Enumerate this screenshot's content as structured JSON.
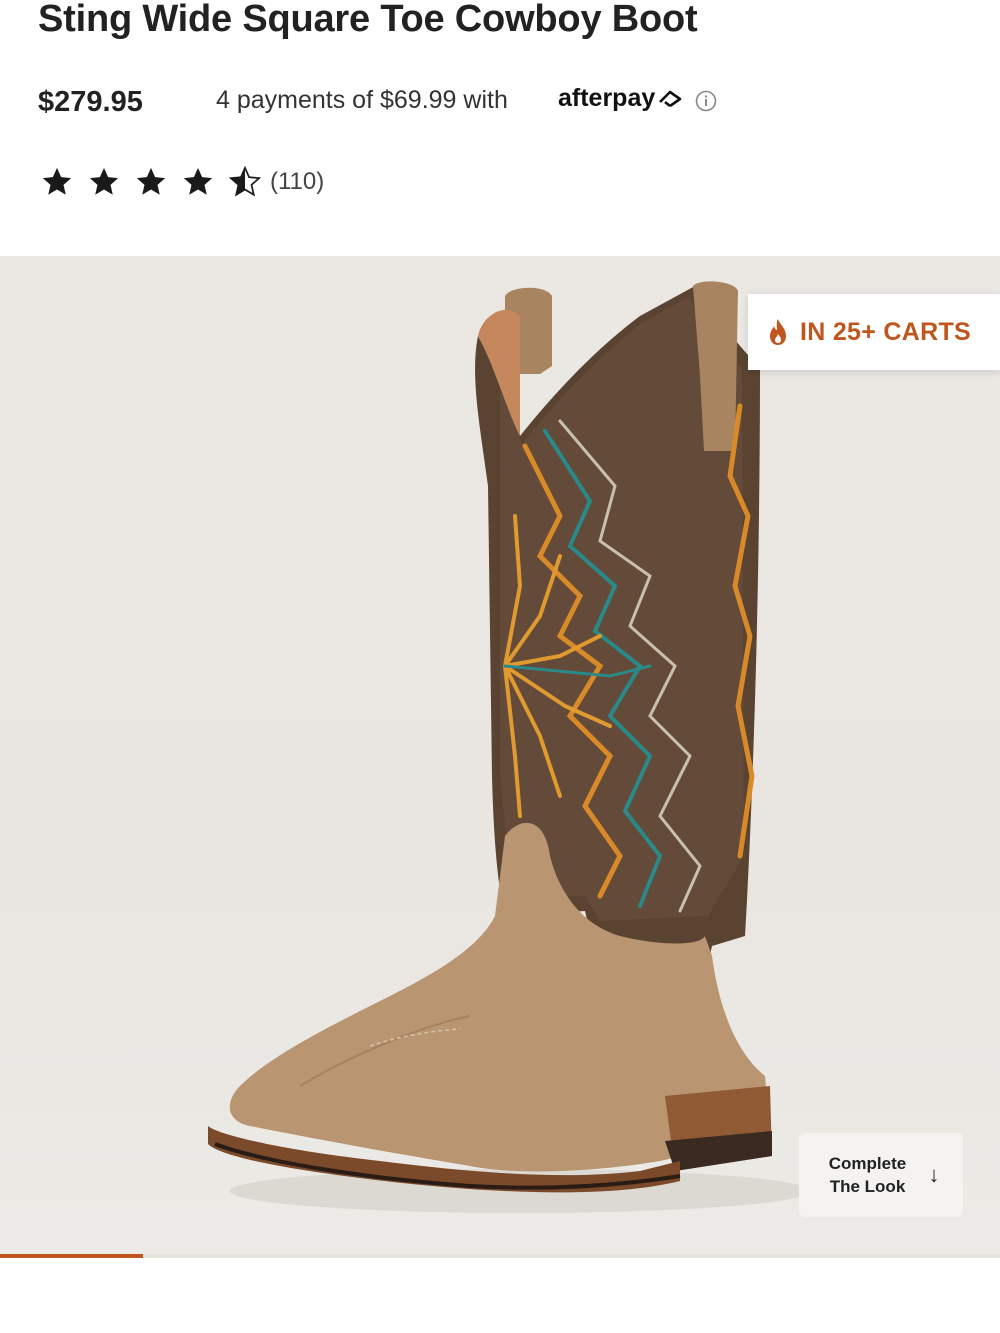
{
  "product": {
    "title": "Sting Wide Square Toe Cowboy Boot",
    "price": "$279.95",
    "afterpay_text": "4 payments of $69.99 with",
    "afterpay_brand": "afterpay",
    "rating": 4.5,
    "review_count": "(110)"
  },
  "hero": {
    "badge_text": "IN 25+ CARTS",
    "badge_icon": "flame-icon",
    "complete_look_label_line1": "Complete",
    "complete_look_label_line2": "The Look",
    "complete_look_icon": "arrow-down-icon"
  },
  "carousel": {
    "progress_fraction": 0.143
  },
  "colors": {
    "accent": "#c0561e",
    "text": "#222222",
    "hero_bg": "#ebe8e4"
  }
}
